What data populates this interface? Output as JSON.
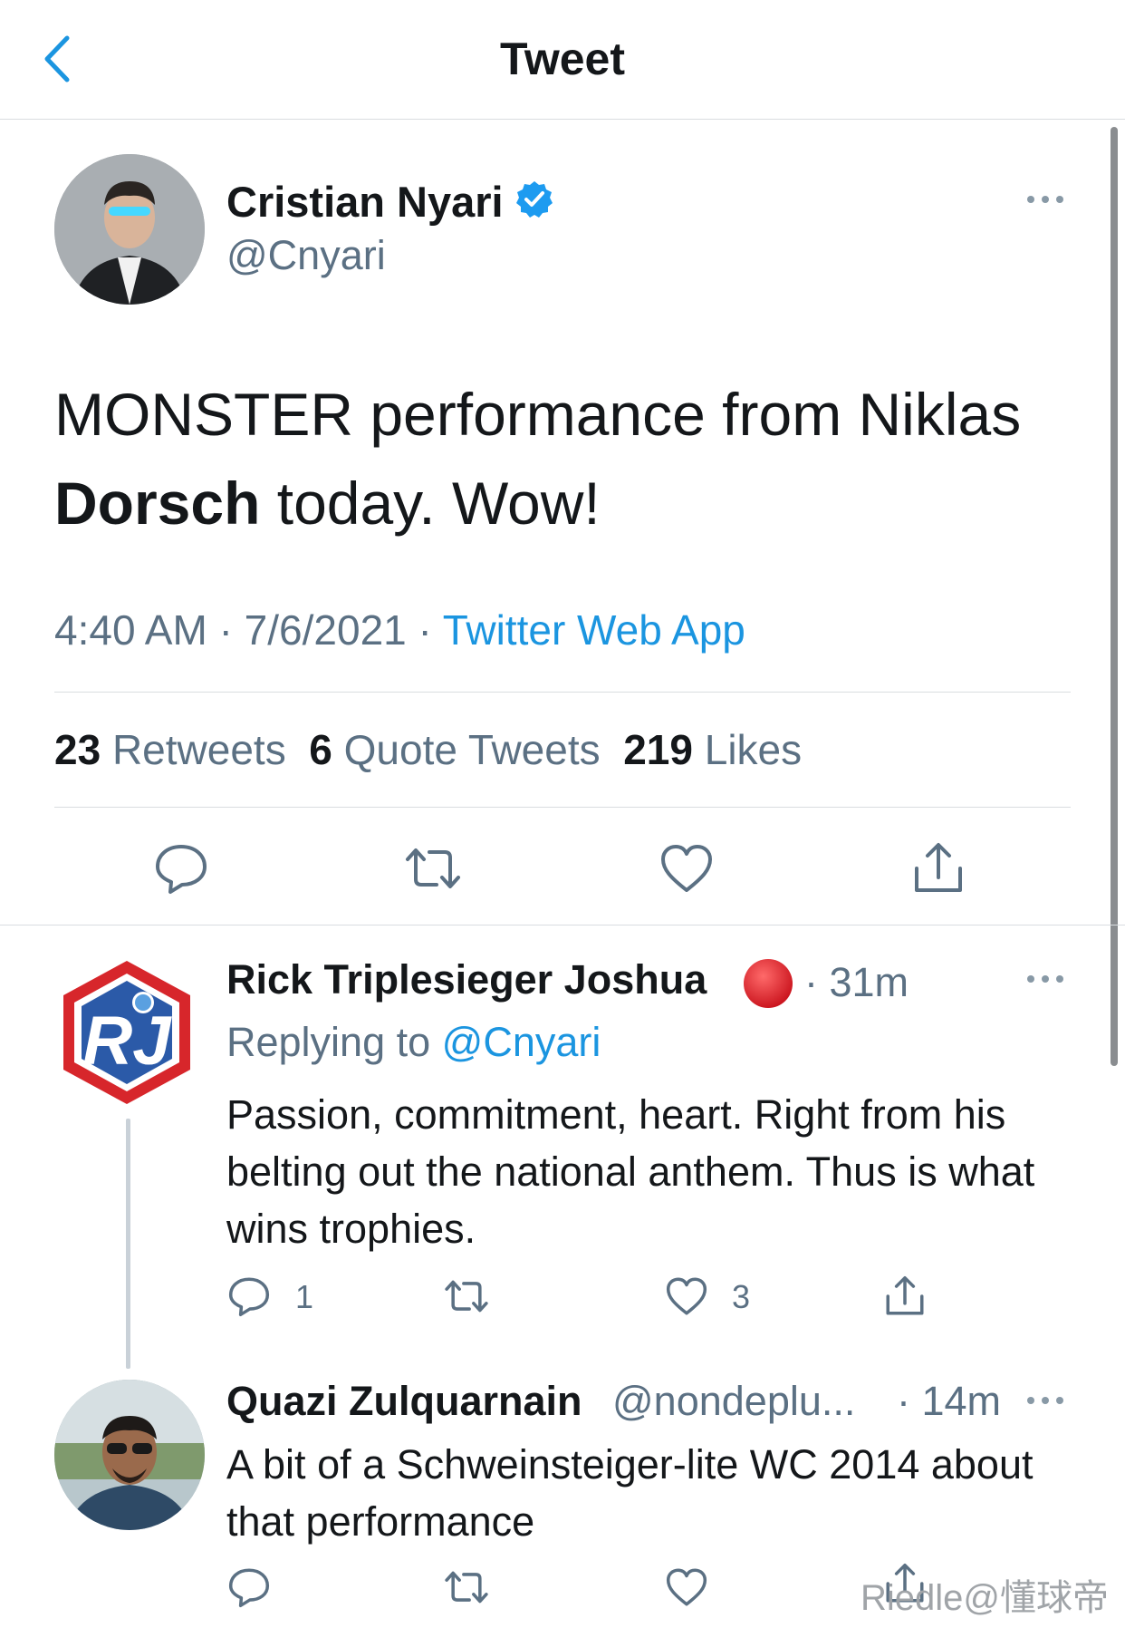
{
  "header": {
    "title": "Tweet"
  },
  "main_tweet": {
    "author_name": "Cristian Nyari",
    "handle": "@Cnyari",
    "text_part1": "MONSTER performance from Niklas ",
    "text_bold": "Dorsch",
    "text_part2": " today. Wow!",
    "time": "4:40 AM",
    "date": "7/6/2021",
    "separator": "·",
    "source": "Twitter Web App",
    "retweets_count": "23",
    "retweets_label": "Retweets",
    "quotes_count": "6",
    "quotes_label": "Quote Tweets",
    "likes_count": "219",
    "likes_label": "Likes"
  },
  "reply1": {
    "author_name": "Rick Triplesieger Joshua",
    "time": "· 31m",
    "replying_prefix": "Replying to",
    "replying_handle": "@Cnyari",
    "text": "Passion, commitment, heart. Right from his belting out the national anthem. Thus is what wins trophies.",
    "reply_count": "1",
    "like_count": "3",
    "avatar_initials": "RJ"
  },
  "reply2": {
    "author_name": "Quazi Zulquarnain",
    "handle": "@nondeplu...",
    "time": "· 14m",
    "text": "A bit of a Schweinsteiger-lite WC 2014 about that performance"
  },
  "watermark": "Riedle@懂球帝",
  "colors": {
    "accent": "#1b95e0",
    "muted": "#5b7083",
    "red_dot": "#e0202a"
  }
}
